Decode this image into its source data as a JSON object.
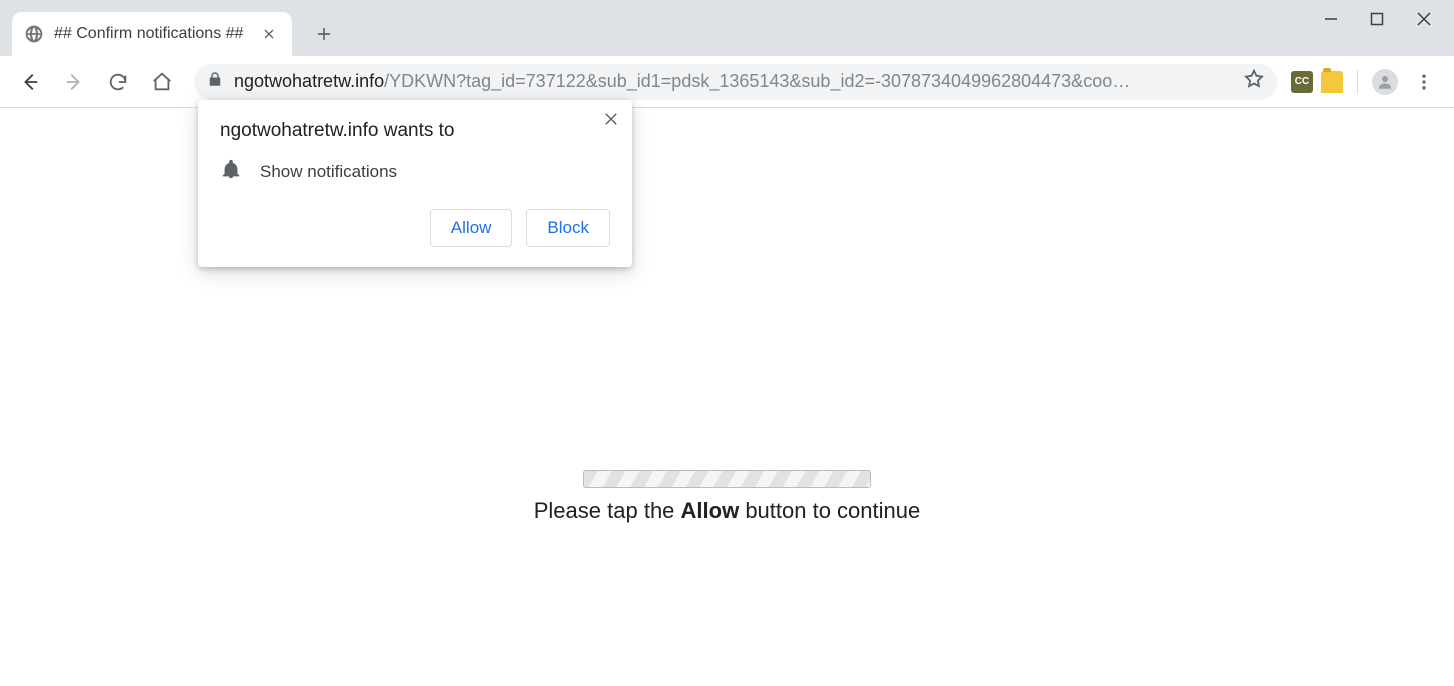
{
  "tab": {
    "title": "## Confirm notifications ##"
  },
  "address": {
    "domain": "ngotwohatretw.info",
    "path": "/YDKWN?tag_id=737122&sub_id1=pdsk_1365143&sub_id2=-3078734049962804473&coo…"
  },
  "permission": {
    "title": "ngotwohatretw.info wants to",
    "item": "Show notifications",
    "allow": "Allow",
    "block": "Block"
  },
  "page": {
    "msg_pre": "Please tap the ",
    "msg_bold": "Allow",
    "msg_post": " button to continue"
  }
}
